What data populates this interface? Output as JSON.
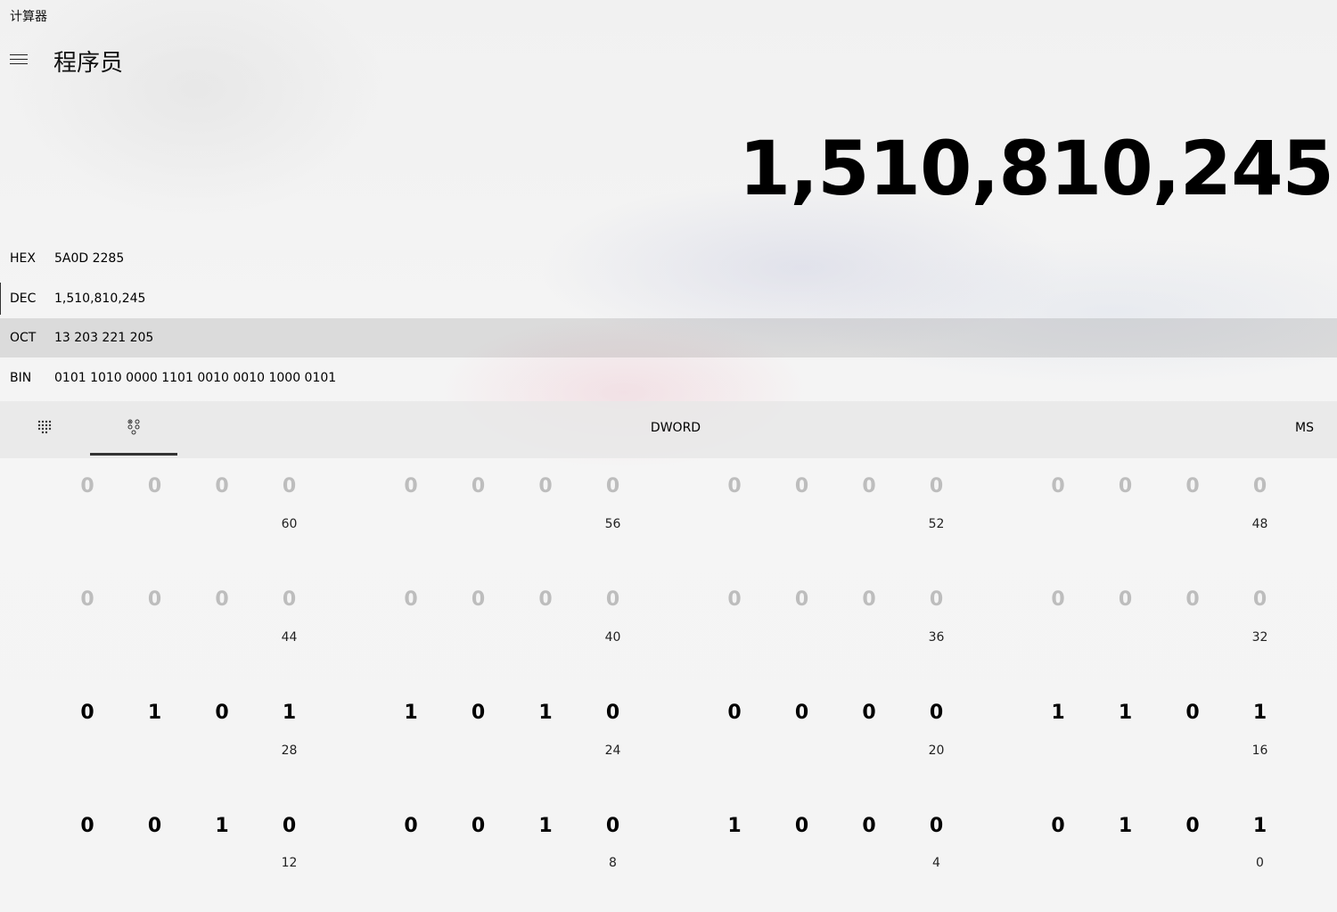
{
  "app": {
    "title": "计算器"
  },
  "header": {
    "mode_title": "程序员",
    "menu_icon": "hamburger-icon"
  },
  "display": {
    "value": "1,510,810,245"
  },
  "radix": [
    {
      "label": "HEX",
      "value": "5A0D 2285",
      "selected": false,
      "active": false
    },
    {
      "label": "DEC",
      "value": "1,510,810,245",
      "selected": false,
      "active": true
    },
    {
      "label": "OCT",
      "value": "13 203 221 205",
      "selected": true,
      "active": false
    },
    {
      "label": "BIN",
      "value": "0101 1010 0000 1101 0010 0010 1000 0101",
      "selected": false,
      "active": false
    }
  ],
  "toolbar": {
    "keypad_icon": "full-keypad-icon",
    "bit_toggle_icon": "bit-toggle-keypad-icon",
    "word_size": "DWORD",
    "memory_store": "MS"
  },
  "bit_rows": [
    {
      "bits": [
        "0",
        "0",
        "0",
        "0",
        "0",
        "0",
        "0",
        "0",
        "0",
        "0",
        "0",
        "0",
        "0",
        "0",
        "0",
        "0"
      ],
      "dim": true,
      "labels": [
        "60",
        "56",
        "52",
        "48"
      ]
    },
    {
      "bits": [
        "0",
        "0",
        "0",
        "0",
        "0",
        "0",
        "0",
        "0",
        "0",
        "0",
        "0",
        "0",
        "0",
        "0",
        "0",
        "0"
      ],
      "dim": true,
      "labels": [
        "44",
        "40",
        "36",
        "32"
      ]
    },
    {
      "bits": [
        "0",
        "1",
        "0",
        "1",
        "1",
        "0",
        "1",
        "0",
        "0",
        "0",
        "0",
        "0",
        "1",
        "1",
        "0",
        "1"
      ],
      "dim": false,
      "labels": [
        "28",
        "24",
        "20",
        "16"
      ]
    },
    {
      "bits": [
        "0",
        "0",
        "1",
        "0",
        "0",
        "0",
        "1",
        "0",
        "1",
        "0",
        "0",
        "0",
        "0",
        "1",
        "0",
        "1"
      ],
      "dim": false,
      "labels": [
        "12",
        "8",
        "4",
        "0"
      ]
    }
  ]
}
